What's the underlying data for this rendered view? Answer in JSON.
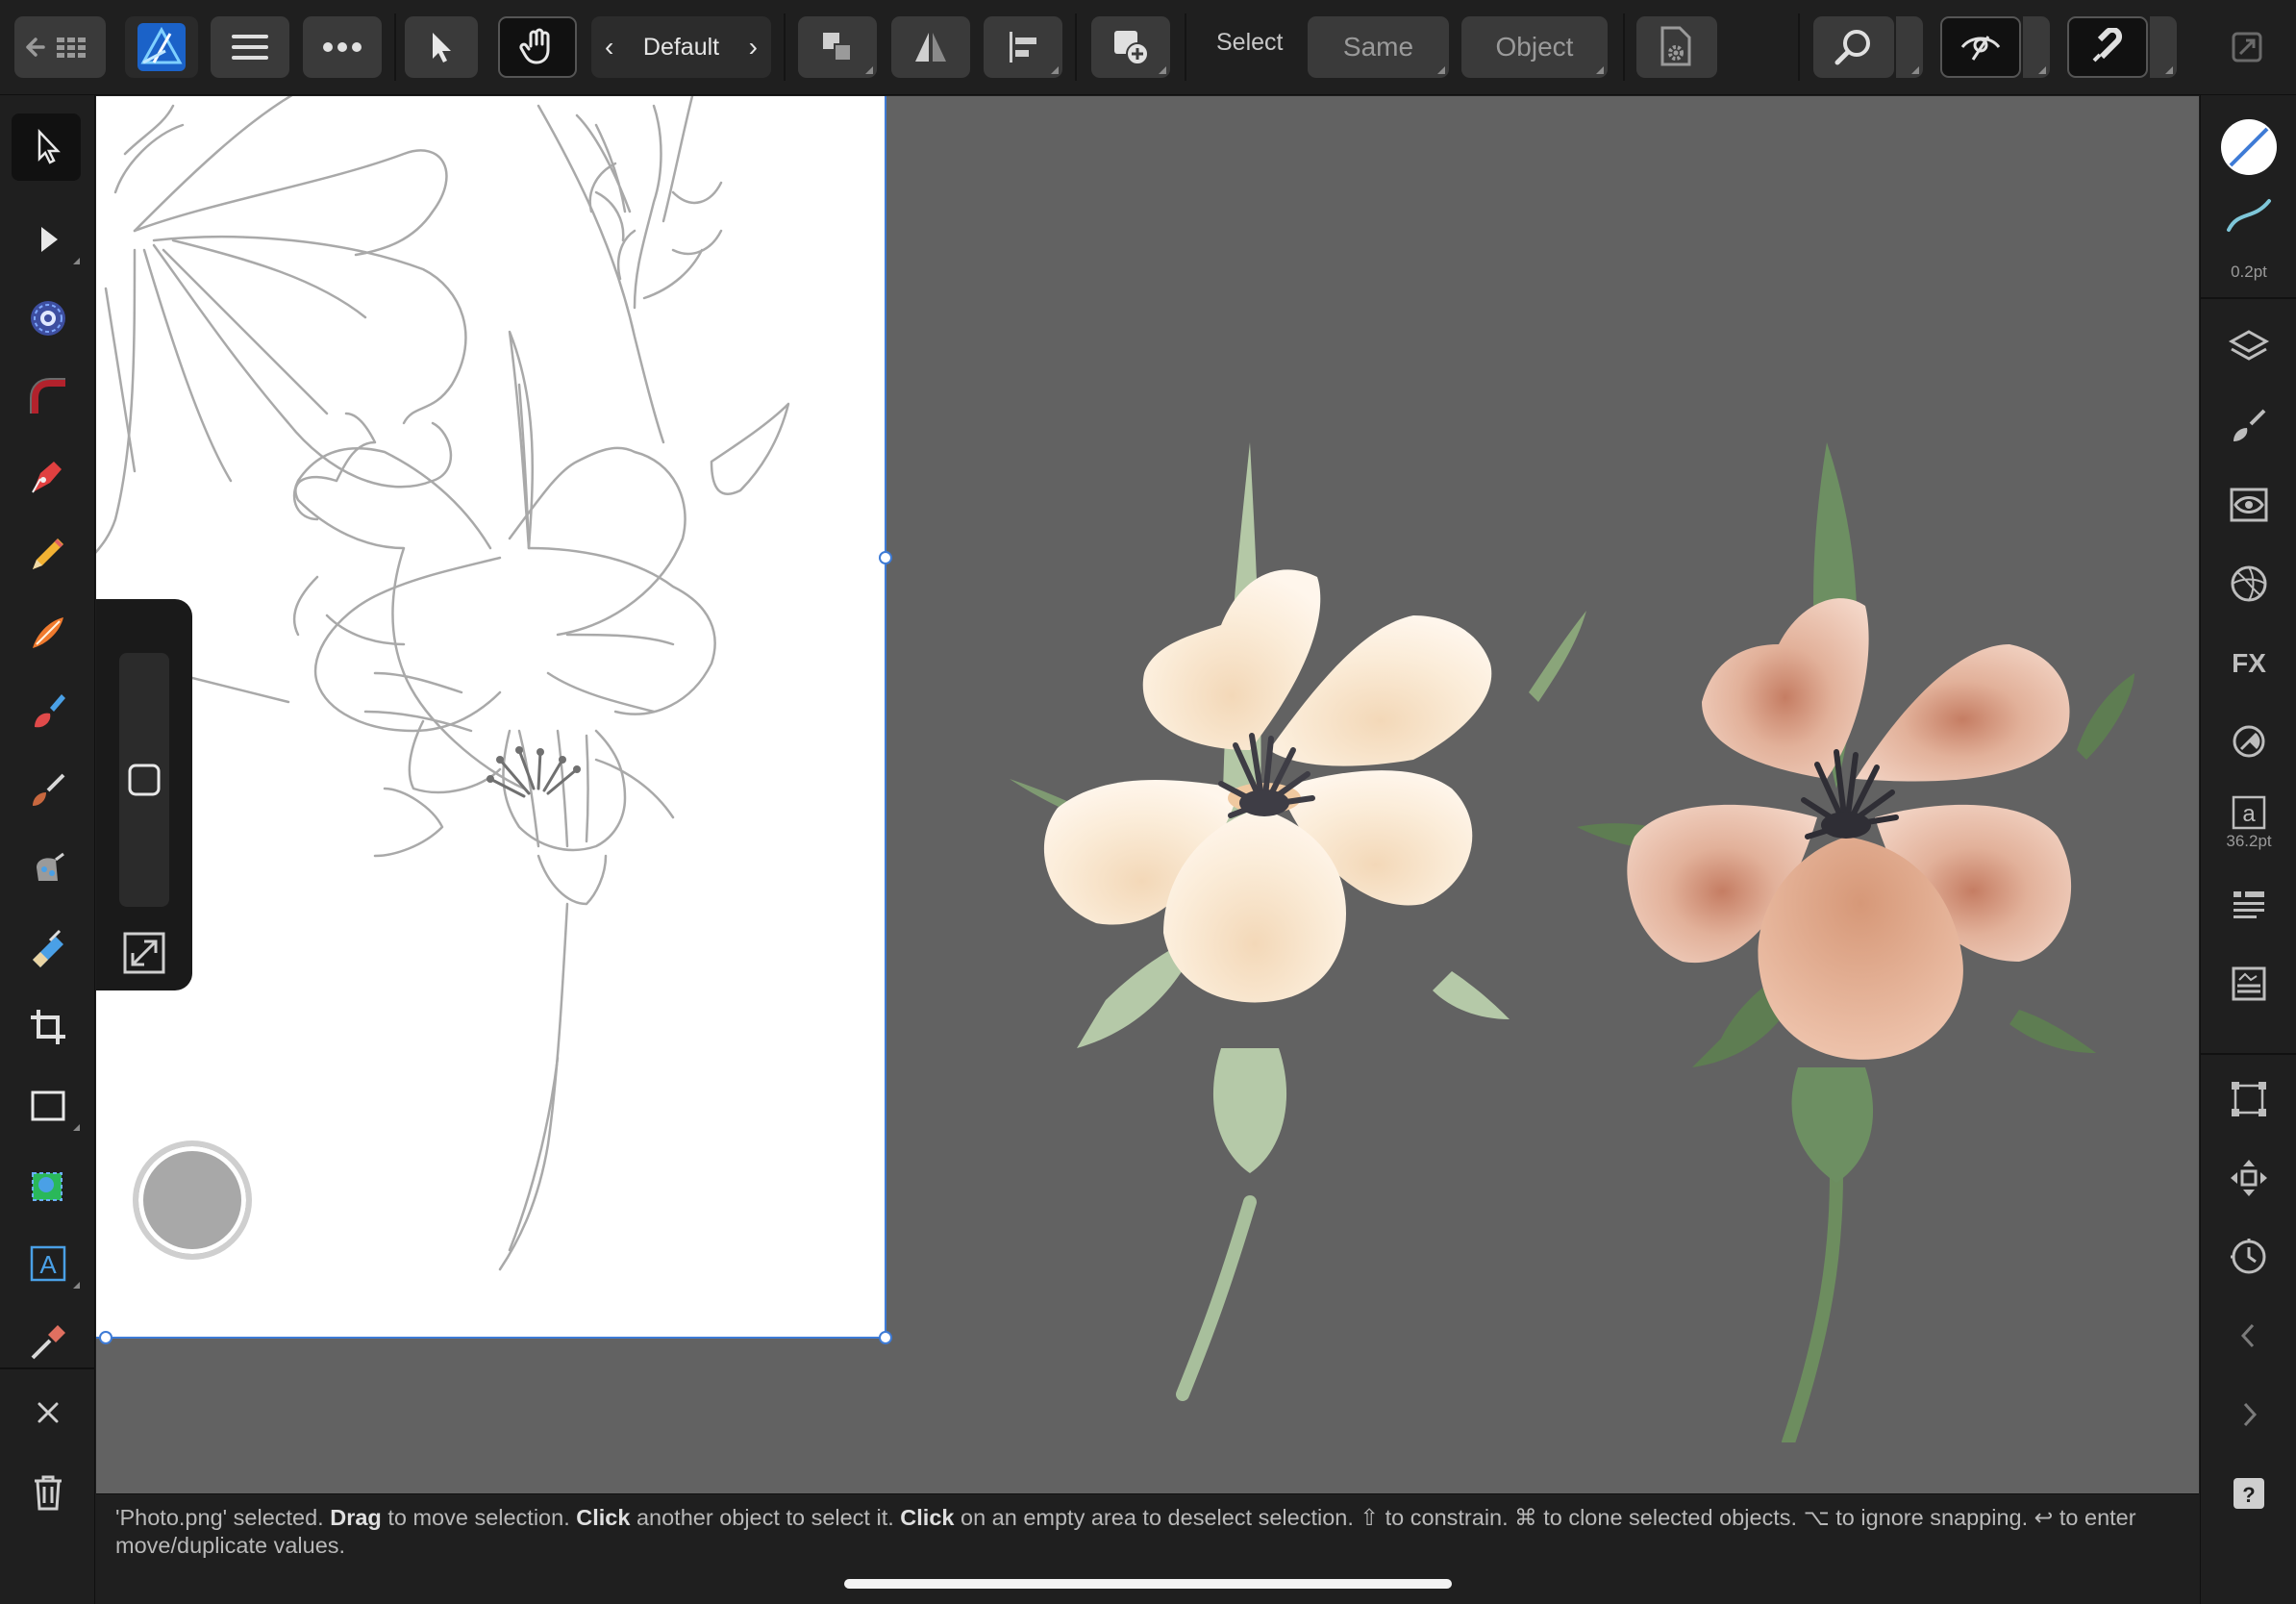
{
  "toolbar": {
    "back_icon": "back-arrow-grid-icon",
    "app_logo": "affinity-designer-logo",
    "menu_icon": "hamburger-icon",
    "more_icon": "ellipsis-icon",
    "persona_label": "Default",
    "select_label": "Select",
    "same_label": "Same",
    "object_label": "Object"
  },
  "tools": [
    {
      "name": "move-tool",
      "icon": "arrow-cursor-icon",
      "active": true
    },
    {
      "name": "node-tool",
      "icon": "node-arrow-icon"
    },
    {
      "name": "contour-tool",
      "icon": "contour-icon"
    },
    {
      "name": "corner-tool",
      "icon": "corner-icon"
    },
    {
      "name": "pen-tool",
      "icon": "pen-nib-icon"
    },
    {
      "name": "pencil-tool",
      "icon": "pencil-icon"
    },
    {
      "name": "vector-brush-tool",
      "icon": "vector-brush-icon"
    },
    {
      "name": "fill-tool",
      "icon": "fill-brush-icon"
    },
    {
      "name": "paint-brush-tool",
      "icon": "paint-brush-icon"
    },
    {
      "name": "transparency-tool",
      "icon": "transparency-icon"
    },
    {
      "name": "pixel-eraser-tool",
      "icon": "eraser-icon"
    },
    {
      "name": "crop-tool",
      "icon": "crop-icon"
    },
    {
      "name": "rectangle-tool",
      "icon": "rectangle-icon"
    },
    {
      "name": "place-image-tool",
      "icon": "place-image-icon"
    },
    {
      "name": "artistic-text-tool",
      "icon": "text-frame-icon"
    },
    {
      "name": "color-picker-tool",
      "icon": "eyedropper-icon"
    }
  ],
  "studio": {
    "stroke_width": "0.2pt",
    "font_size": "36.2pt"
  },
  "colors": {
    "accent": "#3e7bd6",
    "canvas": "#626262",
    "panel": "#1f1f1f"
  },
  "status": {
    "p1": "'Photo.png' selected.",
    "b1": "Drag",
    "p2": "to move selection.",
    "b2": "Click",
    "p3": "another object to select it.",
    "b3": "Click",
    "p4": "on an empty area to deselect selection. ⇧ to constrain. ⌘ to clone selected objects. ⌥ to ignore snapping. ↩ to enter move/duplicate values."
  }
}
